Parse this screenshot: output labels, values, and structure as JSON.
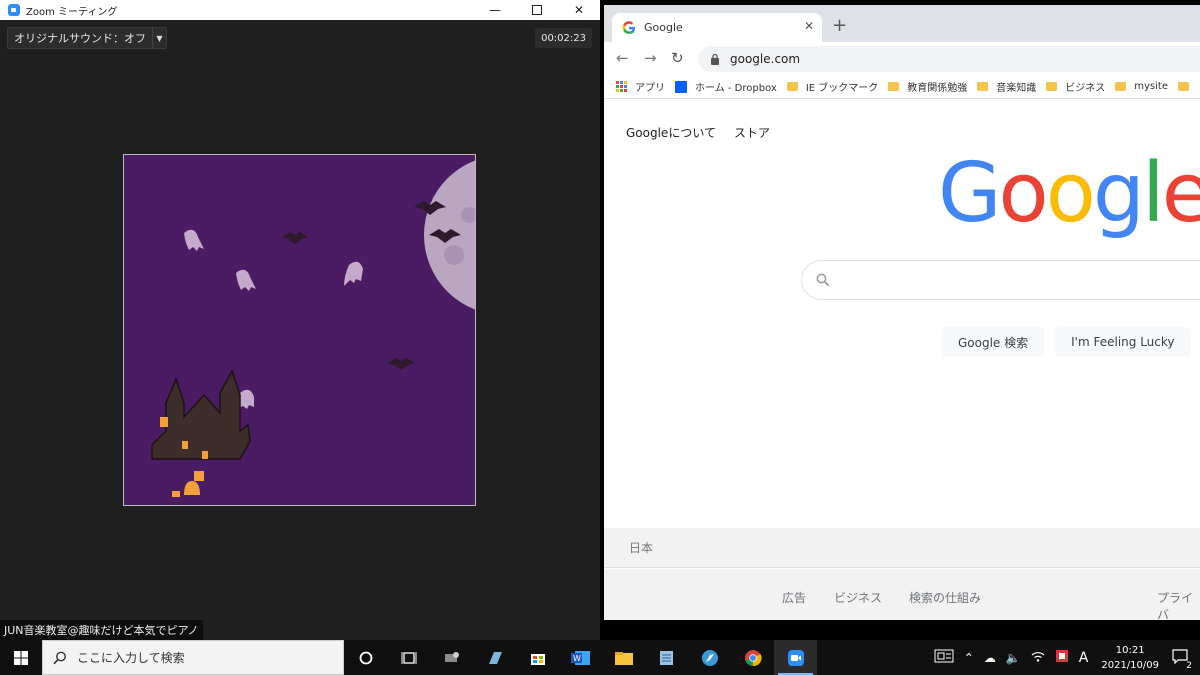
{
  "zoom": {
    "window_title": "Zoom ミーティング",
    "sound_button": "オリジナルサウンド：オフ",
    "timer": "00:02:23",
    "participant_name": "JUN音楽教室@趣味だけど本気でピアノ"
  },
  "chrome": {
    "tab_title": "Google",
    "url": "google.com",
    "bookmarks": [
      {
        "label": "アプリ",
        "icon": "apps-grid-icon"
      },
      {
        "label": "ホーム - Dropbox",
        "icon": "dropbox-icon"
      },
      {
        "label": "IE ブックマーク",
        "icon": "folder-icon"
      },
      {
        "label": "教育関係勉強",
        "icon": "folder-icon"
      },
      {
        "label": "音楽知識",
        "icon": "folder-icon"
      },
      {
        "label": "ビジネス",
        "icon": "folder-icon"
      },
      {
        "label": "mysite",
        "icon": "folder-icon"
      }
    ]
  },
  "google": {
    "top_links": [
      "Googleについて",
      "ストア"
    ],
    "logo_text": "Google",
    "search_button": "Google 検索",
    "lucky_button": "I'm Feeling Lucky",
    "country": "日本",
    "footer_links": [
      "広告",
      "ビジネス",
      "検索の仕組み",
      "プライバ"
    ]
  },
  "taskbar": {
    "search_placeholder": "ここに入力して検索",
    "ime": "A",
    "time": "10:21",
    "date": "2021/10/09",
    "notifications": "2"
  },
  "colors": {
    "google_blue": "#4285f4",
    "google_red": "#ea4335",
    "google_yellow": "#fbbc05",
    "google_green": "#34a853",
    "zoom_blue": "#2d8cff",
    "halloween_purple": "#4a1c63"
  }
}
